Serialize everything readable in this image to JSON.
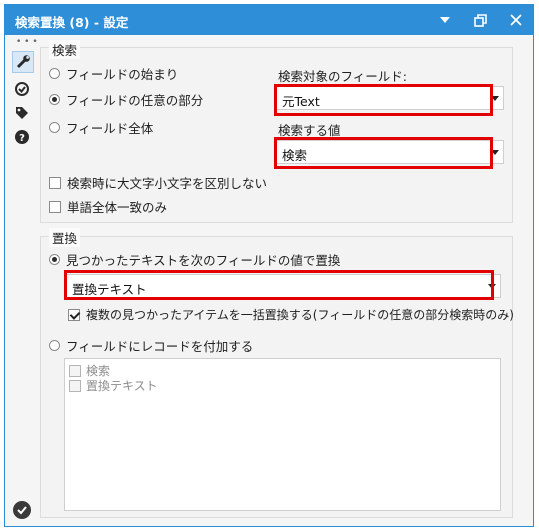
{
  "window": {
    "title": "検索置換 (8) - 設定",
    "controls": {
      "dropdown_icon": "caret-down-icon",
      "restore_icon": "restore-icon",
      "close_icon": "close-icon"
    }
  },
  "sidebar": {
    "items": [
      {
        "name": "configuration",
        "icon": "wrench-icon"
      },
      {
        "name": "annotation",
        "icon": "target-icon"
      },
      {
        "name": "tags",
        "icon": "tag-icon"
      },
      {
        "name": "help",
        "icon": "help-icon"
      }
    ],
    "ok_icon": "check-circle-icon"
  },
  "search": {
    "group_title": "検索",
    "mode_options": [
      {
        "label": "フィールドの始まり",
        "selected": false
      },
      {
        "label": "フィールドの任意の部分",
        "selected": true
      },
      {
        "label": "フィールド全体",
        "selected": false
      }
    ],
    "target_field_label": "検索対象のフィールド:",
    "target_field_value": "元Text",
    "search_value_label": "検索する値",
    "search_value_value": "検索",
    "case_insensitive_label": "検索時に大文字小文字を区別しない",
    "case_insensitive_checked": false,
    "whole_word_label": "単語全体一致のみ",
    "whole_word_checked": false
  },
  "replace": {
    "group_title": "置換",
    "replace_option_label": "見つかったテキストを次のフィールドの値で置換",
    "replace_option_selected": true,
    "replace_field_value": "置換テキスト",
    "replace_all_label": "複数の見つかったアイテムを一括置換する(フィールドの任意の部分検索時のみ)",
    "replace_all_checked": true,
    "append_option_label": "フィールドにレコードを付加する",
    "append_option_selected": false,
    "append_fields": [
      {
        "label": "検索",
        "checked": false
      },
      {
        "label": "置換テキスト",
        "checked": false
      }
    ]
  },
  "colors": {
    "titlebar": "#2e8ed8",
    "highlight": "#e30000"
  }
}
